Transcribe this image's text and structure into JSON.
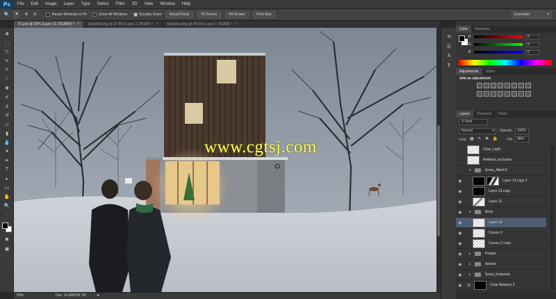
{
  "app": {
    "logo": "Ps"
  },
  "menu": {
    "items": [
      "File",
      "Edit",
      "Image",
      "Layer",
      "Type",
      "Select",
      "Filter",
      "3D",
      "View",
      "Window",
      "Help"
    ]
  },
  "options_bar": {
    "resize_label": "Resize Windows to Fit",
    "zoom_all_label": "Zoom All Windows",
    "scrubby_label": "Scrubby Zoom",
    "actual_pixels": "Actual Pixels",
    "fit_screen": "Fit Screen",
    "fill_screen": "Fill Screen",
    "print_size": "Print Size",
    "workspace": "Essentials"
  },
  "tabs": [
    {
      "label": "01.psd @ 50% (Layer 13, RGB/8#) *",
      "active": true
    },
    {
      "label": "bj7pb8rl.bmp @ 27.8% (Layer 2, RGB/8) *",
      "active": false
    },
    {
      "label": "bzgtsfps.bmp @ 45.9% (Layer 2, RGB/8) *",
      "active": false
    }
  ],
  "canvas": {
    "watermark": "www.cgtsj.com"
  },
  "status": {
    "zoom": "50%",
    "doc": "Doc: 14.3M/256.7M"
  },
  "color_panel": {
    "tabs": [
      "Color",
      "Swatches"
    ],
    "r_label": "R",
    "g_label": "G",
    "b_label": "B",
    "r": "0",
    "g": "0",
    "b": "0"
  },
  "adjustments_panel": {
    "tabs": [
      "Adjustments",
      "Styles"
    ],
    "title": "Add an adjustment"
  },
  "layers_panel": {
    "tabs": [
      "Layers",
      "Channels",
      "Paths"
    ],
    "kind": "Kind",
    "blend_mode": "Normal",
    "opacity_label": "Opacity:",
    "opacity": "100%",
    "lock_label": "Lock:",
    "fill_label": "Fill:",
    "fill": "38%",
    "layers": [
      {
        "name": "Glow_Light",
        "kind": "layer",
        "thumb": "light",
        "indent": 0,
        "visible": false
      },
      {
        "name": "Ambient_occlusion",
        "kind": "layer",
        "thumb": "light",
        "indent": 0,
        "visible": false
      },
      {
        "name": "Snow_AfterFX",
        "kind": "group",
        "indent": 0,
        "visible": false,
        "open": true
      },
      {
        "name": "Layer 13 copy 2",
        "kind": "layer",
        "thumb": "dark",
        "mask": true,
        "indent": 1,
        "visible": true
      },
      {
        "name": "Layer 13 copy",
        "kind": "layer",
        "thumb": "dark",
        "indent": 1,
        "visible": true
      },
      {
        "name": "Layer 12",
        "kind": "layer",
        "thumb": "snow",
        "indent": 1,
        "visible": true
      },
      {
        "name": "Birds",
        "kind": "group",
        "indent": 0,
        "visible": true,
        "open": true
      },
      {
        "name": "Layer 13",
        "kind": "layer",
        "thumb": "checker",
        "indent": 1,
        "visible": true,
        "selected": true
      },
      {
        "name": "Curves 2",
        "kind": "layer",
        "thumb": "checker",
        "indent": 1,
        "visible": true
      },
      {
        "name": "Curves 2 copy",
        "kind": "layer",
        "thumb": "checker",
        "indent": 1,
        "visible": true
      },
      {
        "name": "People",
        "kind": "group",
        "indent": 0,
        "visible": true,
        "open": false
      },
      {
        "name": "Animal",
        "kind": "group",
        "indent": 0,
        "visible": true,
        "open": false
      },
      {
        "name": "Snow_footprints",
        "kind": "group",
        "indent": 0,
        "visible": true,
        "open": false
      },
      {
        "name": "Color Balance 2",
        "kind": "adjustment",
        "thumb": "dark",
        "indent": 0,
        "visible": true
      }
    ]
  }
}
